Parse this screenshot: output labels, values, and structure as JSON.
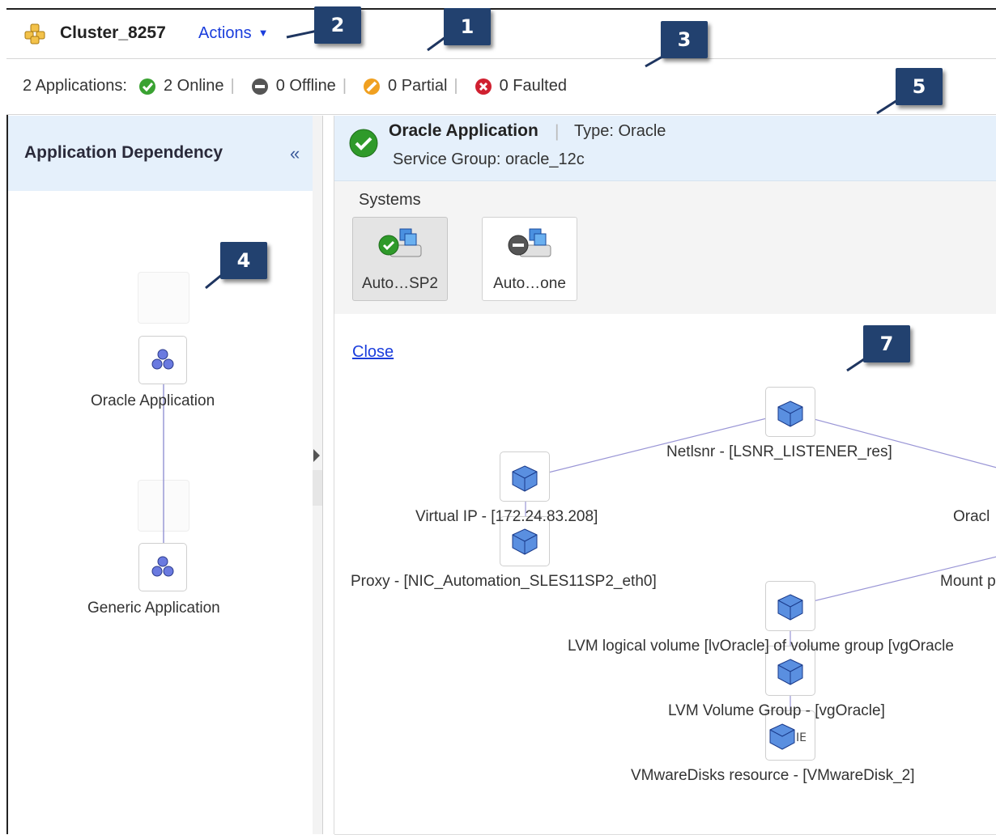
{
  "header": {
    "cluster_name": "Cluster_8257",
    "actions_label": "Actions"
  },
  "status": {
    "apps_label": "2 Applications:",
    "online": "2 Online",
    "offline": "0 Offline",
    "partial": "0 Partial",
    "faulted": "0 Faulted",
    "colors": {
      "online": "#3aa232",
      "offline": "#555555",
      "partial": "#f0a020",
      "faulted": "#d02030"
    }
  },
  "left_panel": {
    "title": "Application Dependency",
    "collapse_icon": "double-chevron-left-icon",
    "nodes": [
      "Oracle Application",
      "Generic Application"
    ]
  },
  "right_panel": {
    "app_name": "Oracle Application",
    "type_label": "Type: Oracle",
    "service_group": "Service Group:  oracle_12c",
    "systems_label": "Systems",
    "systems": [
      {
        "label": "Auto…SP2",
        "state": "online"
      },
      {
        "label": "Auto…one",
        "state": "offline"
      }
    ],
    "close_label": "Close",
    "resources": {
      "netlsnr": "Netlsnr - [LSNR_LISTENER_res]",
      "vip": "Virtual IP - [172.24.83.208]",
      "proxy": "Proxy - [NIC_Automation_SLES11SP2_eth0]",
      "oracle": "Oracl",
      "mount": "Mount p",
      "lvm_lv": "LVM logical volume [lvOracle] of volume group [vgOracle",
      "lvm_vg": "LVM Volume Group - [vgOracle]",
      "vmdisk": "VMwareDisks resource - [VMwareDisk_2]"
    }
  },
  "callouts": [
    "1",
    "2",
    "3",
    "4",
    "5",
    "7"
  ],
  "accent_colors": {
    "callout_bg": "#22416f",
    "header_bg": "#e5f0fb",
    "link": "#1a3ddc"
  }
}
